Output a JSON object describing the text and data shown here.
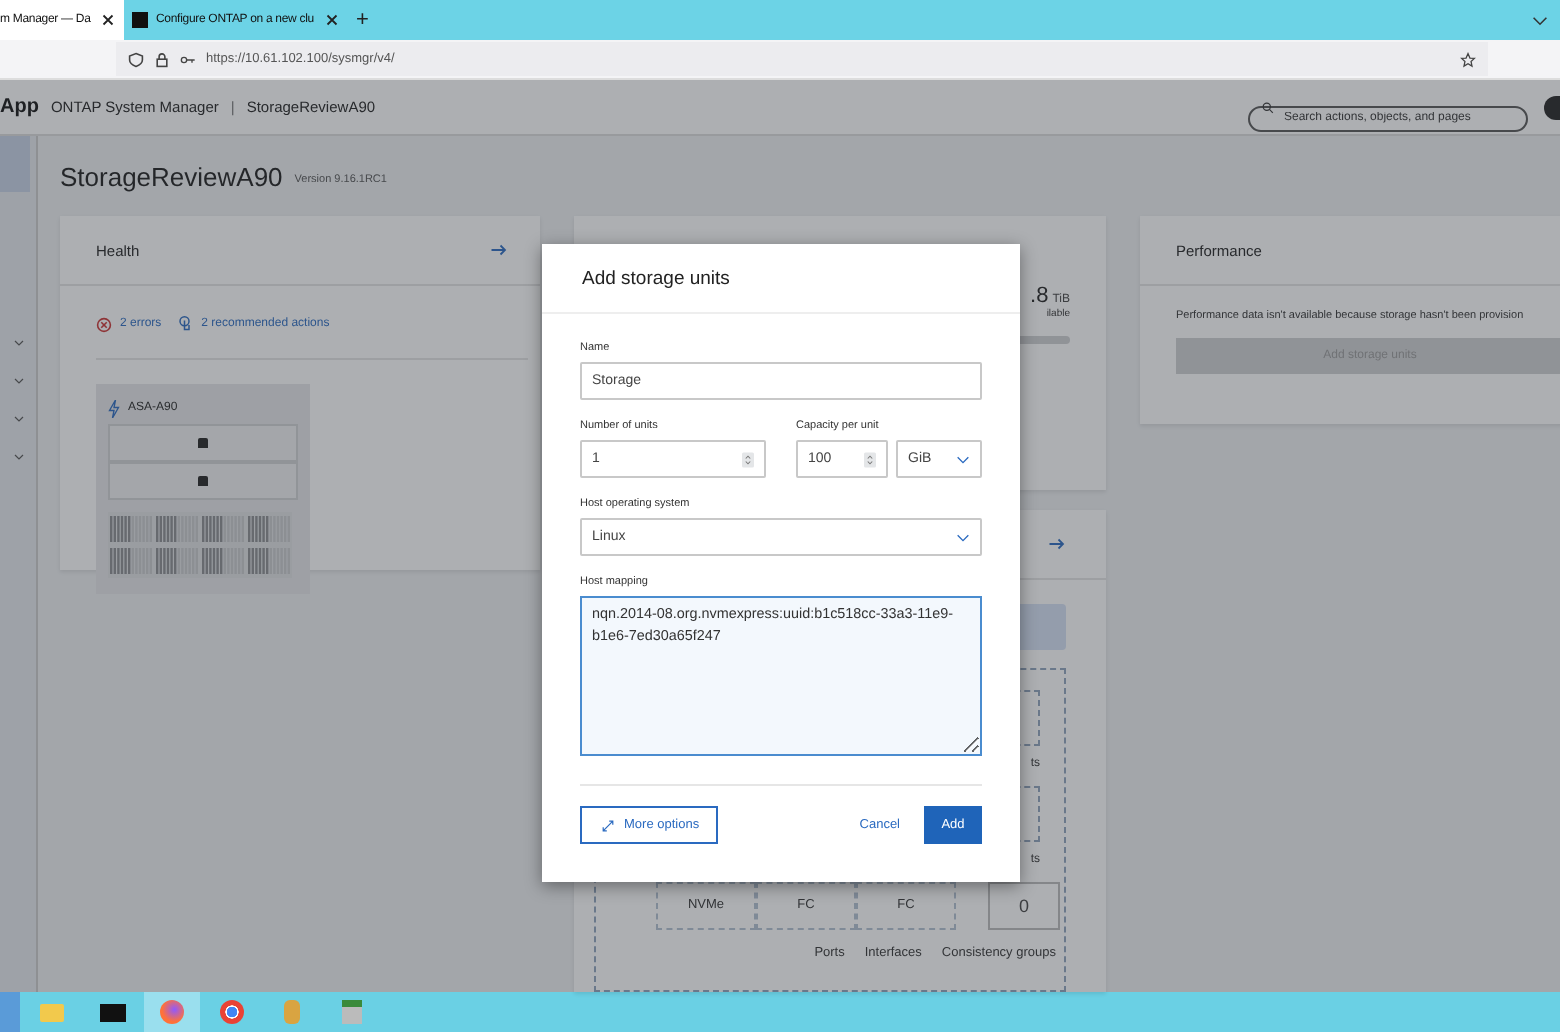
{
  "browser": {
    "tabs": [
      {
        "title": "m Manager — Da",
        "selected": true
      },
      {
        "title": "Configure ONTAP on a new clu",
        "selected": false
      }
    ],
    "new_tab": "+",
    "url": "https://10.61.102.100/sysmgr/v4/"
  },
  "app": {
    "brand": "App",
    "product": "ONTAP System Manager",
    "separator": "|",
    "cluster": "StorageReviewA90",
    "search": {
      "placeholder": "Search actions, objects, and pages"
    }
  },
  "page": {
    "title": "StorageReviewA90",
    "version": "Version 9.16.1RC1"
  },
  "health": {
    "title": "Health",
    "errors": "2 errors",
    "actions": "2 recommended actions",
    "system": "ASA-A90"
  },
  "capacity": {
    "value": ".8",
    "unit": "TiB",
    "caption": "ilable"
  },
  "protocols": {
    "partial_labels": [
      "ts",
      "ts"
    ],
    "items": [
      {
        "label": "NVMe"
      },
      {
        "label": "FC"
      },
      {
        "label": "FC"
      }
    ],
    "consistency_count": "0",
    "footer": [
      "Ports",
      "Interfaces",
      "Consistency groups"
    ]
  },
  "performance": {
    "title": "Performance",
    "message": "Performance data isn't available because storage hasn't been provision",
    "button": {
      "label": "Add storage units",
      "disabled": true
    }
  },
  "dialog": {
    "title": "Add storage units",
    "name": {
      "label": "Name",
      "value": "Storage"
    },
    "units": {
      "label": "Number of units",
      "value": "1"
    },
    "capacity": {
      "label": "Capacity per unit",
      "value": "100",
      "unit": "GiB"
    },
    "host_os": {
      "label": "Host operating system",
      "value": "Linux"
    },
    "host_mapping": {
      "label": "Host mapping",
      "value": "nqn.2014-08.org.nvmexpress:uuid:b1c518cc-33a3-11e9-b1e6-7ed30a65f247"
    },
    "more_options": "More options",
    "cancel": "Cancel",
    "add": "Add"
  }
}
